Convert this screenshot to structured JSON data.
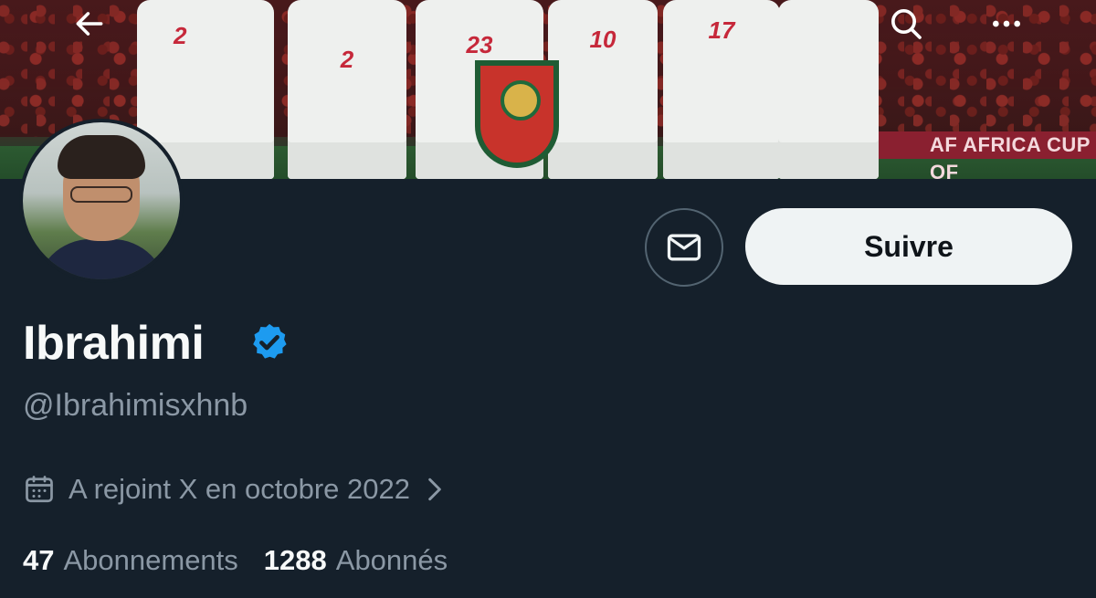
{
  "header": {
    "back_icon": "arrow-left-icon",
    "search_icon": "search-icon",
    "more_icon": "more-horizontal-icon"
  },
  "banner": {
    "board_text": "AF  AFRICA CUP OF",
    "jersey_numbers": [
      "2",
      "2",
      "23",
      "10",
      "17"
    ]
  },
  "profile": {
    "name": "Ibrahimi",
    "handle": "@Ibrahimisxhnb",
    "verified": true,
    "verified_color": "#1d9bf0",
    "joined_text": "A rejoint X en octobre 2022",
    "following_count": "47",
    "following_label": "Abonnements",
    "followers_count": "1288",
    "followers_label": "Abonnés"
  },
  "actions": {
    "message_icon": "mail-icon",
    "follow_label": "Suivre"
  },
  "colors": {
    "background": "#15202b",
    "follow_button_bg": "#eff3f4",
    "secondary_text": "#8b98a5"
  }
}
